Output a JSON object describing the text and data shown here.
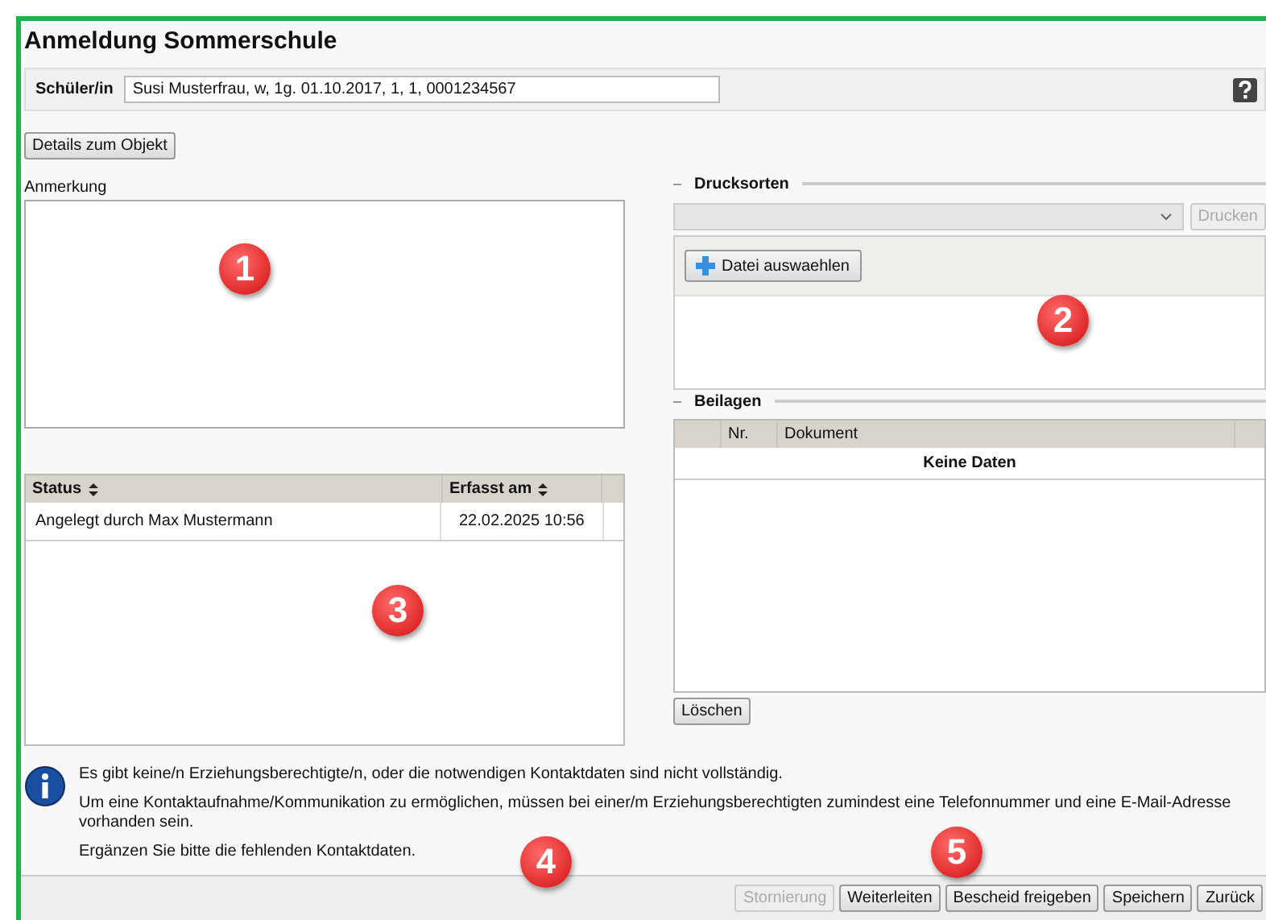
{
  "title": "Anmeldung Sommerschule",
  "student": {
    "label": "Schüler/in",
    "value": "Susi Musterfrau, w, 1g. 01.10.2017, 1, 1, 0001234567"
  },
  "details_button": "Details zum Objekt",
  "remark": {
    "label": "Anmerkung",
    "marker": "1"
  },
  "status_table": {
    "columns": [
      "Status",
      "Erfasst am"
    ],
    "marker": "3",
    "rows": [
      {
        "status": "Angelegt durch Max Mustermann",
        "date": "22.02.2025 10:56"
      }
    ]
  },
  "print_types": {
    "legend": "Drucksorten",
    "print_button": {
      "label": "Drucken",
      "disabled": true
    },
    "file_button": "Datei auswaehlen",
    "marker": "2"
  },
  "attachments": {
    "legend": "Beilagen",
    "columns": [
      "Nr.",
      "Dokument"
    ],
    "empty_text": "Keine Daten",
    "delete_button": "Löschen"
  },
  "info": {
    "marker": "4",
    "lines": [
      "Es gibt keine/n Erziehungsberechtigte/n, oder die notwendigen Kontaktdaten sind nicht vollständig.",
      "Um eine Kontaktaufnahme/Kommunikation zu ermöglichen, müssen bei einer/m Erziehungsberechtigten zumindest eine Telefonnummer und eine E-Mail-Adresse vorhanden sein.",
      "Ergänzen Sie bitte die fehlenden Kontaktdaten."
    ]
  },
  "actions_marker": "5",
  "actions": [
    {
      "label": "Stornierung",
      "disabled": true
    },
    {
      "label": "Weiterleiten",
      "disabled": false
    },
    {
      "label": "Bescheid freigeben",
      "disabled": false
    },
    {
      "label": "Speichern",
      "disabled": false
    },
    {
      "label": "Zurück",
      "disabled": false
    }
  ]
}
